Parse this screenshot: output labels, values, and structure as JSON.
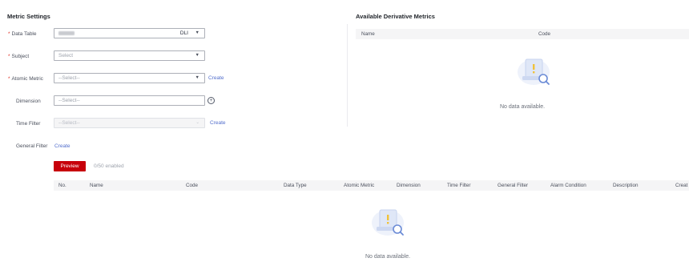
{
  "metric_settings": {
    "title": "Metric Settings",
    "data_table": {
      "label": "Data Table",
      "tag": "DLI"
    },
    "subject": {
      "label": "Subject",
      "placeholder": "Select"
    },
    "atomic_metric": {
      "label": "Atomic Metric",
      "placeholder": "--Select--",
      "create_label": "Create"
    },
    "dimension": {
      "label": "Dimension",
      "placeholder": "--Select--"
    },
    "time_filter": {
      "label": "Time Filter",
      "placeholder": "--Select--",
      "create_label": "Create"
    },
    "general_filter": {
      "label": "General Filter",
      "create_label": "Create"
    },
    "preview_label": "Preview",
    "enabled_count": "0/50 enabled"
  },
  "derivative": {
    "title": "Available Derivative Metrics",
    "columns": [
      "Name",
      "Code"
    ],
    "empty_text": "No data available."
  },
  "results_table": {
    "columns": [
      "No.",
      "Name",
      "Code",
      "Data Type",
      "Atomic Metric",
      "Dimension",
      "Time Filter",
      "General Filter",
      "Alarm Condition",
      "Description",
      "Creat"
    ],
    "empty_text": "No data available."
  },
  "colors": {
    "accent": "#c7000b",
    "link": "#526ecc",
    "required": "#e02e24"
  },
  "icons": {
    "empty_state": "empty-document-search-icon",
    "add": "plus-circle-icon",
    "dropdown": "chevron-down-icon"
  }
}
